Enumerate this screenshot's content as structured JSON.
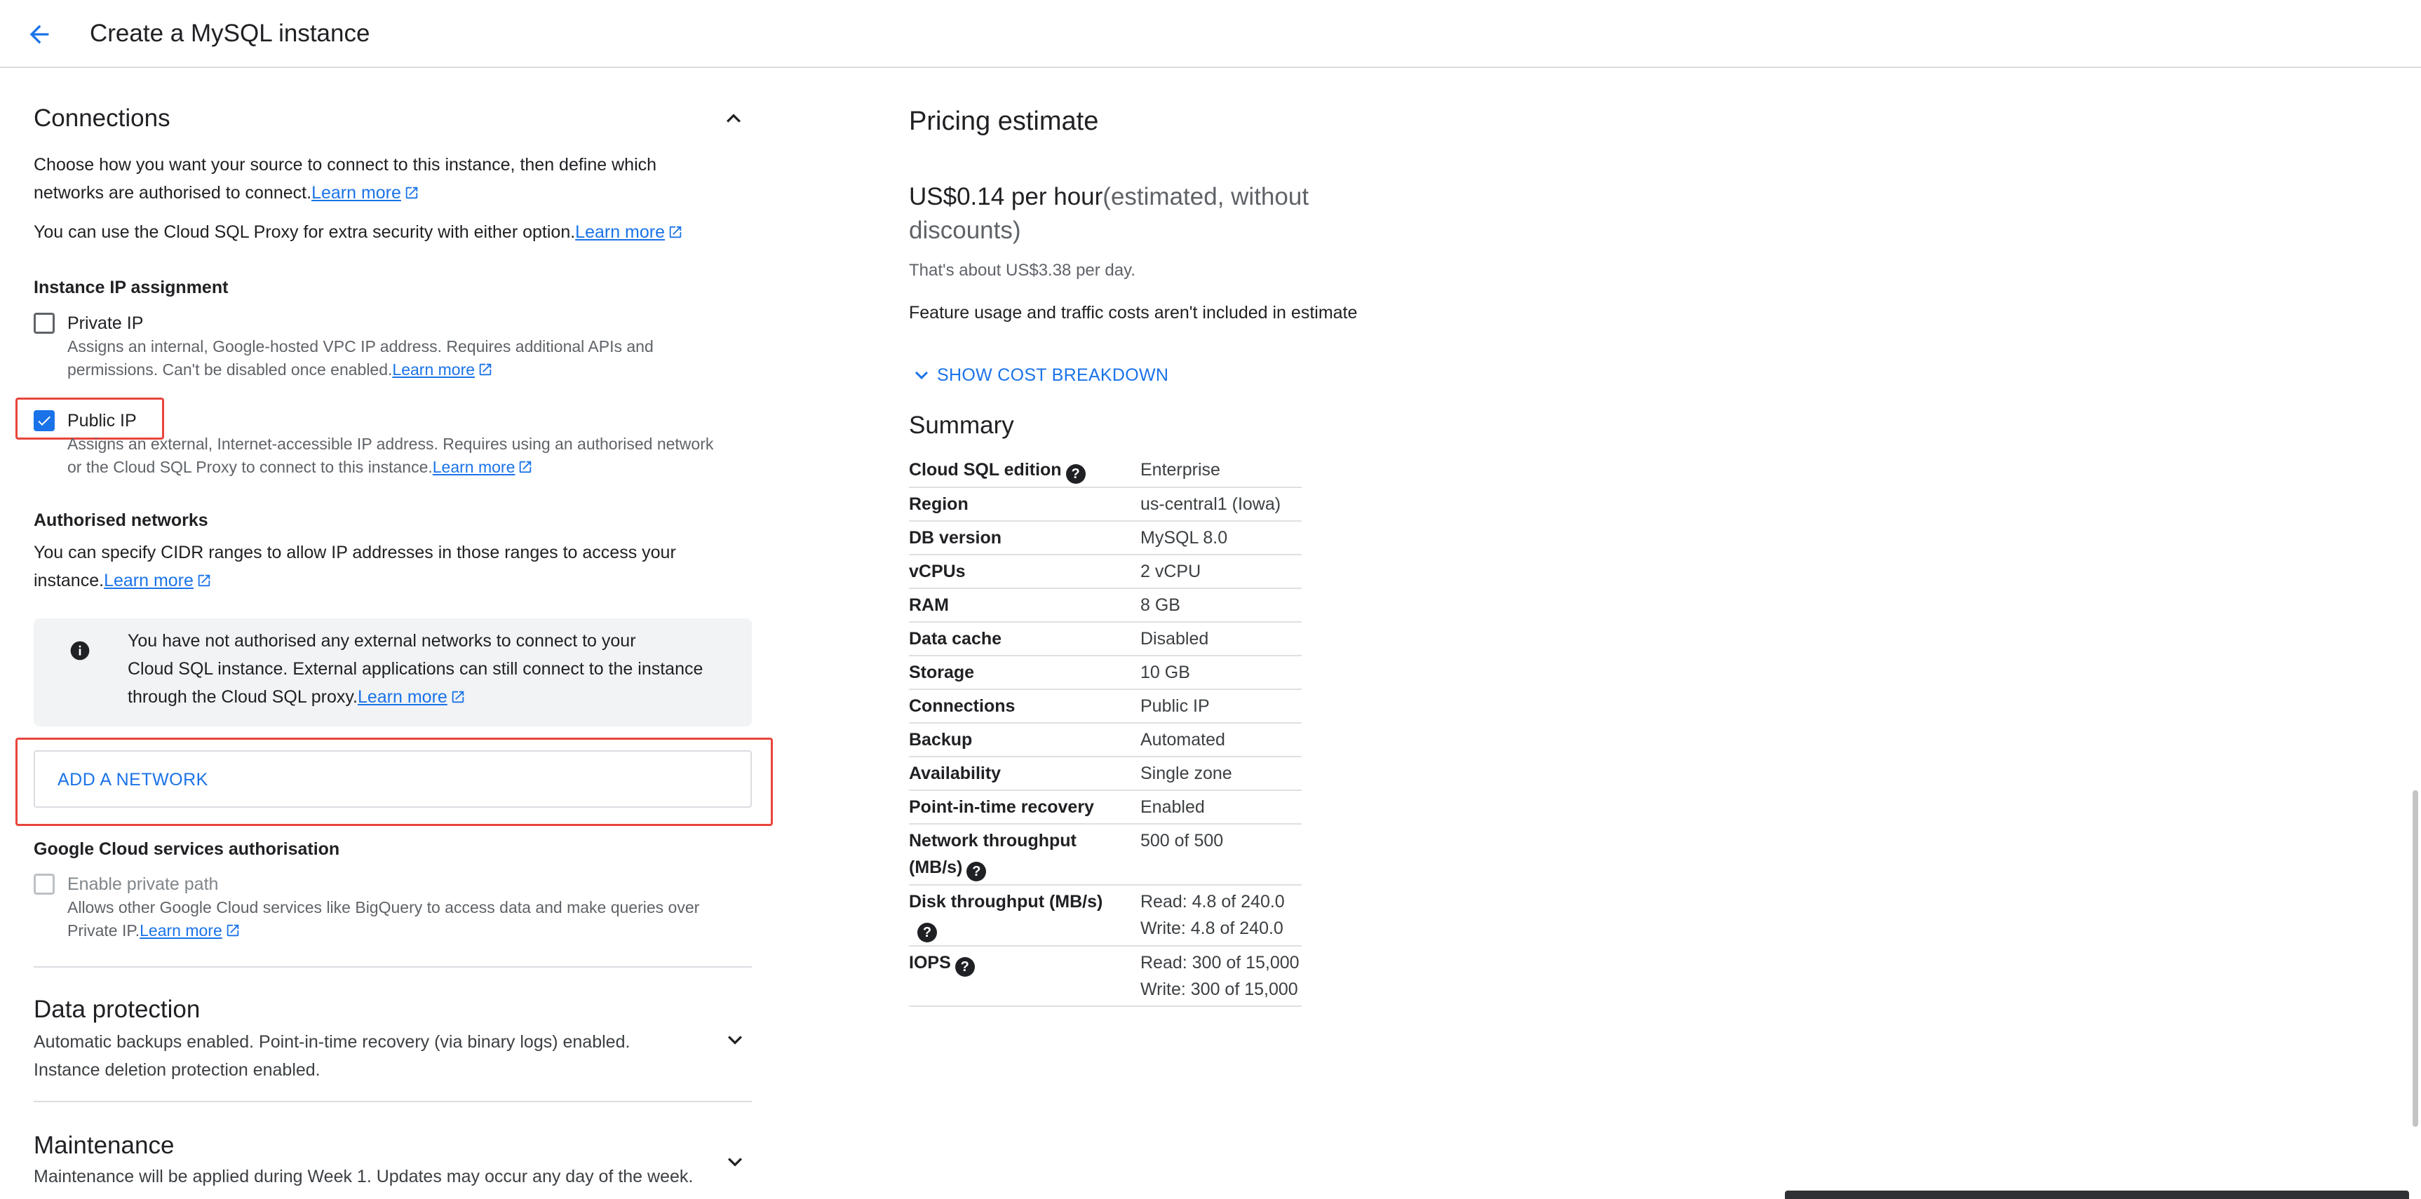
{
  "header": {
    "title": "Create a MySQL instance"
  },
  "connections": {
    "title": "Connections",
    "intro_line1": "Choose how you want your source to connect to this instance, then define which",
    "intro_line2": "networks are authorised to connect.",
    "learn_more": "Learn more",
    "proxy_text": "You can use the Cloud SQL Proxy for extra security with either option.",
    "ip_assignment_heading": "Instance IP assignment",
    "private_ip": {
      "label": "Private IP",
      "checked": false,
      "desc_line1": "Assigns an internal, Google-hosted VPC IP address. Requires additional APIs and",
      "desc_line2": "permissions. Can't be disabled once enabled."
    },
    "public_ip": {
      "label": "Public IP",
      "checked": true,
      "desc_line1": "Assigns an external, Internet-accessible IP address. Requires using an authorised network",
      "desc_line2": "or the Cloud SQL Proxy to connect to this instance."
    },
    "authorised_networks": {
      "heading": "Authorised networks",
      "desc_line1": "You can specify CIDR ranges to allow IP addresses in those ranges to access your",
      "desc_line2": "instance.",
      "info_line1": "You have not authorised any external networks to connect to your",
      "info_line2": "Cloud SQL instance. External applications can still connect to the instance",
      "info_line3": "through the Cloud SQL proxy.",
      "add_button": "ADD A NETWORK"
    },
    "gcs_auth": {
      "heading": "Google Cloud services authorisation",
      "label": "Enable private path",
      "desc_line1": "Allows other Google Cloud services like BigQuery to access data and make queries over",
      "desc_line2": "Private IP."
    }
  },
  "data_protection": {
    "title": "Data protection",
    "desc_line1": "Automatic backups enabled. Point-in-time recovery (via binary logs) enabled.",
    "desc_line2": "Instance deletion protection enabled."
  },
  "maintenance": {
    "title": "Maintenance",
    "desc": "Maintenance will be applied during Week 1. Updates may occur any day of the week."
  },
  "pricing": {
    "title": "Pricing estimate",
    "price": "US$0.14 per hour",
    "price_note_1": "(estimated, without",
    "price_note_2": "discounts)",
    "per_day": "That's about US$3.38 per day.",
    "feature_note": "Feature usage and traffic costs aren't included in estimate",
    "breakdown_button": "SHOW COST BREAKDOWN"
  },
  "summary": {
    "title": "Summary",
    "rows": [
      {
        "key": "Cloud SQL edition",
        "help": true,
        "value": "Enterprise"
      },
      {
        "key": "Region",
        "value": "us-central1 (Iowa)"
      },
      {
        "key": "DB version",
        "value": "MySQL 8.0"
      },
      {
        "key": "vCPUs",
        "value": "2 vCPU"
      },
      {
        "key": "RAM",
        "value": "8 GB"
      },
      {
        "key": "Data cache",
        "value": "Disabled"
      },
      {
        "key": "Storage",
        "value": "10 GB"
      },
      {
        "key": "Connections",
        "value": "Public IP"
      },
      {
        "key": "Backup",
        "value": "Automated"
      },
      {
        "key": "Availability",
        "value": "Single zone"
      },
      {
        "key": "Point-in-time recovery",
        "value": "Enabled"
      },
      {
        "key_line1": "Network throughput",
        "key_line2": "(MB/s)",
        "help": true,
        "value": "500 of 500"
      },
      {
        "key_line1": "Disk throughput (MB/s)",
        "help": true,
        "value_line1": "Read: 4.8 of 240.0",
        "value_line2": "Write: 4.8 of 240.0"
      },
      {
        "key": "IOPS",
        "help": true,
        "value_line1": "Read: 300 of 15,000",
        "value_line2": "Write: 300 of 15,000"
      }
    ]
  },
  "icons": {
    "back": "arrow-back-icon",
    "external": "open-in-new-icon",
    "info": "info-icon",
    "help": "help-icon",
    "collapse": "chevron-up-icon",
    "expand": "chevron-down-icon"
  },
  "colors": {
    "accent": "#1a73e8",
    "highlight": "#e8453c",
    "text": "#202124",
    "muted": "#5f6368"
  }
}
